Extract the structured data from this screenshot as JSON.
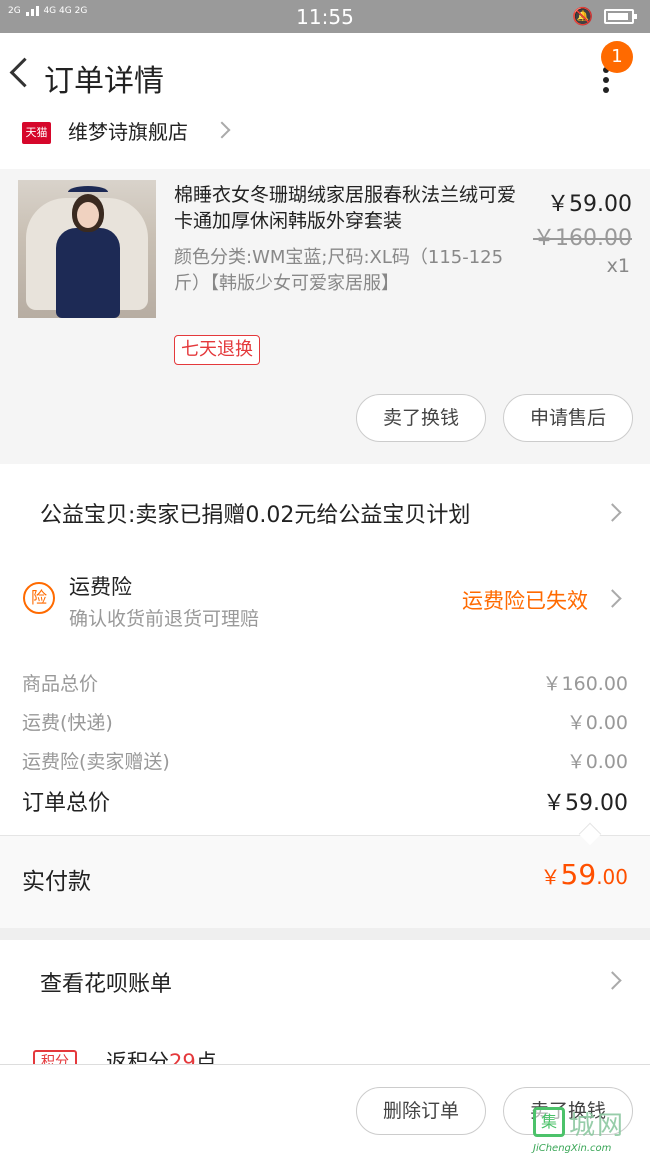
{
  "status_bar": {
    "signal_1": "2G",
    "signal_2": "4G 4G",
    "signal_3": "2G",
    "time": "11:55"
  },
  "header": {
    "title": "订单详情",
    "badge_count": "1"
  },
  "store": {
    "platform_tag": "天猫",
    "name": "维梦诗旗舰店"
  },
  "product": {
    "name": "棉睡衣女冬珊瑚绒家居服春秋法兰绒可爱卡通加厚休闲韩版外穿套装",
    "spec": "颜色分类:WM宝蓝;尺码:XL码（115-125斤）【韩版少女可爱家居服】",
    "price": "￥59.00",
    "original_price": "￥160.00",
    "quantity": "x1",
    "tag": "七天退换",
    "sell_button": "卖了换钱",
    "after_sale_button": "申请售后"
  },
  "charity": {
    "text": "公益宝贝:卖家已捐赠0.02元给公益宝贝计划"
  },
  "insurance": {
    "icon_label": "险",
    "title": "运费险",
    "subtitle": "确认收货前退货可理赔",
    "status": "运费险已失效"
  },
  "costs": [
    {
      "label": "商品总价",
      "value": "￥160.00"
    },
    {
      "label": "运费(快递)",
      "value": "￥0.00"
    },
    {
      "label": "运费险(卖家赠送)",
      "value": "￥0.00"
    }
  ],
  "order_total": {
    "label": "订单总价",
    "value": "￥59.00"
  },
  "paid": {
    "label": "实付款",
    "currency": "￥",
    "integer": "59",
    "decimal": ".00"
  },
  "huabei": {
    "text": "查看花呗账单"
  },
  "points": {
    "tag": "积分",
    "text_prefix": "返积分",
    "amount": "29",
    "text_suffix": "点"
  },
  "bottom_bar": {
    "delete_button": "删除订单",
    "sell_button": "卖了换钱"
  },
  "watermark": {
    "logo": "集",
    "cn": "城网",
    "en": "JiChengXin.com"
  },
  "colors": {
    "accent": "#ff6a00",
    "price_red": "#ff5000",
    "tmall_red": "#d6072b"
  }
}
